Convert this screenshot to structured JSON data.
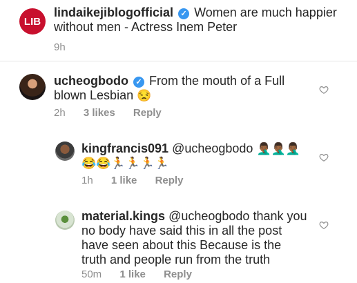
{
  "post": {
    "avatar_text": "LIB",
    "username": "lindaikejiblogofficial",
    "caption": "Women are much happier without men - Actress Inem Peter",
    "time": "9h"
  },
  "comments": [
    {
      "username": "ucheogbodo",
      "text": "From the mouth of a Full blown Lesbian",
      "emoji": "😒",
      "time": "2h",
      "likes": "3 likes",
      "reply": "Reply"
    },
    {
      "username": "kingfrancis091",
      "mention": "@ucheogbodo",
      "emoji_line1": "🤦🏾‍♂️🤦🏾‍♂️🤦🏾‍♂️",
      "emoji_line2": "😂😂🏃🏃🏃🏃",
      "time": "1h",
      "likes": "1 like",
      "reply": "Reply"
    },
    {
      "username": "material.kings",
      "mention": "@ucheogbodo",
      "text": "thank you no body have said this in all the post have seen about this  Because is the truth and people run from the truth",
      "time": "50m",
      "likes": "1 like",
      "reply": "Reply"
    }
  ],
  "colors": {
    "verified": "#3897f0",
    "lib_red": "#c8102e",
    "meta": "#8e8e8e"
  }
}
